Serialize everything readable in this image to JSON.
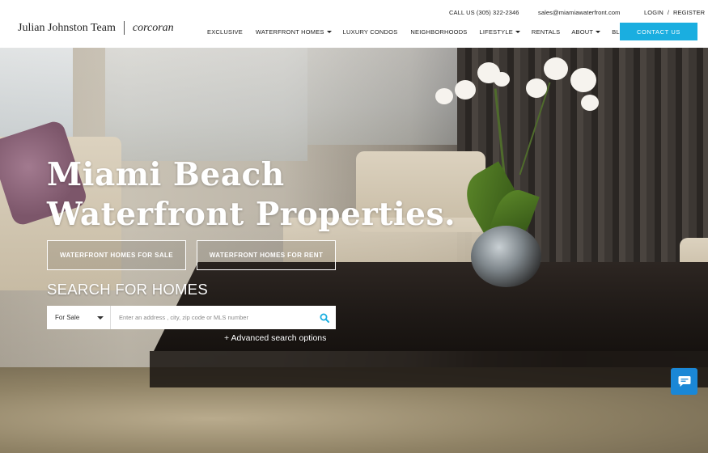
{
  "header": {
    "logo_name": "Julian Johnston Team",
    "logo_brand": "corcoran",
    "phone": "CALL US (305) 322-2346",
    "email": "sales@miamiawaterfront.com",
    "login": "LOGIN",
    "auth_sep": "/",
    "register": "REGISTER",
    "contact": "CONTACT US",
    "accent_color": "#1aaee0"
  },
  "nav": {
    "items": [
      {
        "label": "EXCLUSIVE",
        "dropdown": false
      },
      {
        "label": "WATERFRONT HOMES",
        "dropdown": true
      },
      {
        "label": "LUXURY CONDOS",
        "dropdown": false
      },
      {
        "label": "NEIGHBORHOODS",
        "dropdown": false
      },
      {
        "label": "LIFESTYLE",
        "dropdown": true
      },
      {
        "label": "RENTALS",
        "dropdown": false
      },
      {
        "label": "ABOUT",
        "dropdown": true
      },
      {
        "label": "BLOG",
        "dropdown": false
      }
    ]
  },
  "hero": {
    "title_line1": "Miami Beach",
    "title_line2": "Waterfront Properties.",
    "btn_sale": "WATERFRONT HOMES FOR SALE",
    "btn_rent": "WATERFRONT HOMES FOR RENT"
  },
  "search": {
    "title": "SEARCH FOR HOMES",
    "select_value": "For Sale",
    "placeholder": "Enter an address , city, zip code or MLS number",
    "advanced": "+ Advanced search options",
    "icon_color": "#1aaee0"
  },
  "chat": {
    "color": "#1a87d6"
  }
}
